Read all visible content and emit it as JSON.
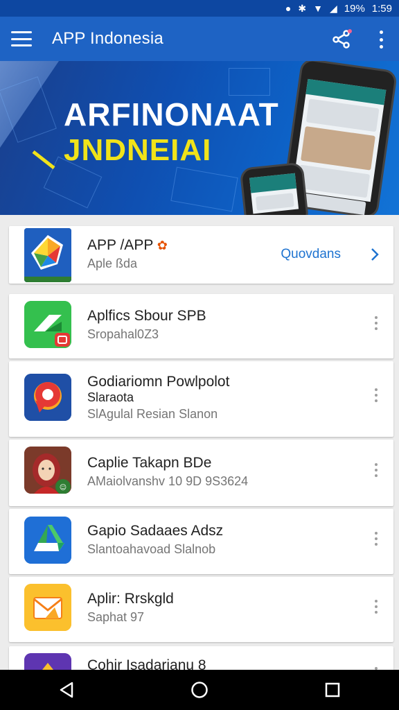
{
  "status_bar": {
    "battery": "19%",
    "time": "1:59"
  },
  "app_bar": {
    "title": "APP Indonesia"
  },
  "banner": {
    "line1": "ARFINONAAT",
    "line2": "JNDNEIAI"
  },
  "featured": {
    "name": "APP /APP",
    "subtitle": "Aple ßda",
    "action_label": "Quovdans"
  },
  "apps": [
    {
      "name": "Aplfics Sbour SPB",
      "line2": "",
      "subtitle": "Sropahal0Z3",
      "icon": "green-share-icon"
    },
    {
      "name": "Godiariomn Powlpolot",
      "line2": "Slaraota",
      "subtitle": "SlAgulal Resian Slanon",
      "icon": "location-pin-icon"
    },
    {
      "name": "Caplie Takapn BDe",
      "line2": "",
      "subtitle": "AMaiolvanshv 10 9D 9S3624",
      "icon": "avatar-icon"
    },
    {
      "name": "Gapio Sadaaes Adsz",
      "line2": "",
      "subtitle": "Slantoahavoad Slalnob",
      "icon": "drive-icon"
    },
    {
      "name": "Aplir: Rrskgld",
      "line2": "",
      "subtitle": "Saphat 97",
      "icon": "envelope-icon"
    },
    {
      "name": "Cohir Isadarianu 8",
      "line2": "",
      "subtitle": "",
      "icon": "purple-app-icon"
    }
  ],
  "colors": {
    "app_bar": "#1e63c4",
    "status_bar": "#0d47a1",
    "accent": "#1e73d0",
    "banner_yellow": "#f0e31a"
  }
}
